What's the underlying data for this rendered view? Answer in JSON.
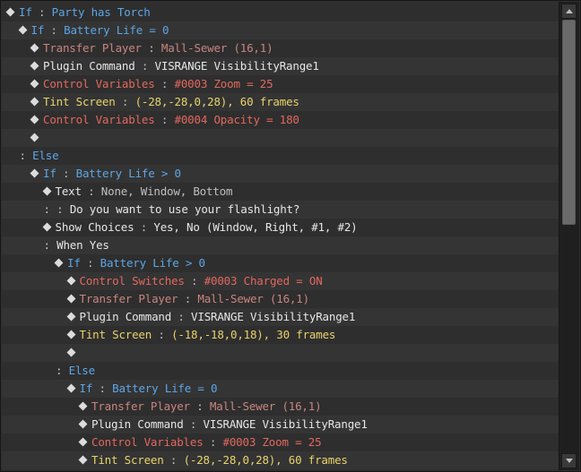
{
  "rows": [
    {
      "indent": 0,
      "diamond": true,
      "parts": [
        {
          "t": "If",
          "c": "c-blue"
        },
        {
          "t": " : ",
          "c": "colon-sep"
        },
        {
          "t": "Party has Torch",
          "c": "c-blue"
        }
      ]
    },
    {
      "indent": 1,
      "diamond": true,
      "parts": [
        {
          "t": "If",
          "c": "c-blue"
        },
        {
          "t": " : ",
          "c": "colon-sep"
        },
        {
          "t": "Battery Life = 0",
          "c": "c-blue"
        }
      ]
    },
    {
      "indent": 2,
      "diamond": true,
      "parts": [
        {
          "t": "Transfer Player",
          "c": "c-red-dim"
        },
        {
          "t": " : ",
          "c": "colon-sep"
        },
        {
          "t": "Mall-Sewer (16,1)",
          "c": "c-red-dim"
        }
      ]
    },
    {
      "indent": 2,
      "diamond": true,
      "parts": [
        {
          "t": "Plugin Command",
          "c": "c-white"
        },
        {
          "t": " : ",
          "c": "colon-sep"
        },
        {
          "t": "VISRANGE VisibilityRange1",
          "c": "c-white"
        }
      ]
    },
    {
      "indent": 2,
      "diamond": true,
      "parts": [
        {
          "t": "Control Variables",
          "c": "c-red"
        },
        {
          "t": " : ",
          "c": "colon-sep"
        },
        {
          "t": "#0003 Zoom = 25",
          "c": "c-red"
        }
      ]
    },
    {
      "indent": 2,
      "diamond": true,
      "parts": [
        {
          "t": "Tint Screen",
          "c": "c-yellow"
        },
        {
          "t": " : ",
          "c": "colon-sep"
        },
        {
          "t": "(-28,-28,0,28), 60 frames",
          "c": "c-yellow"
        }
      ]
    },
    {
      "indent": 2,
      "diamond": true,
      "parts": [
        {
          "t": "Control Variables",
          "c": "c-red"
        },
        {
          "t": " : ",
          "c": "colon-sep"
        },
        {
          "t": "#0004 Opacity = 180",
          "c": "c-red"
        }
      ]
    },
    {
      "indent": 2,
      "diamond": true,
      "parts": []
    },
    {
      "indent": 1,
      "diamond": false,
      "parts": [
        {
          "t": " : ",
          "c": "colon-sep"
        },
        {
          "t": "Else",
          "c": "c-blue"
        }
      ]
    },
    {
      "indent": 2,
      "diamond": true,
      "parts": [
        {
          "t": "If",
          "c": "c-blue"
        },
        {
          "t": " : ",
          "c": "colon-sep"
        },
        {
          "t": "Battery Life > 0",
          "c": "c-blue"
        }
      ]
    },
    {
      "indent": 3,
      "diamond": true,
      "parts": [
        {
          "t": "Text",
          "c": "c-white"
        },
        {
          "t": " : ",
          "c": "colon-sep"
        },
        {
          "t": "None, Window, Bottom",
          "c": "c-gray"
        }
      ]
    },
    {
      "indent": 3,
      "diamond": false,
      "parts": [
        {
          "t": " :       : ",
          "c": "colon-sep"
        },
        {
          "t": "Do you want to use your flashlight?",
          "c": "c-white"
        }
      ]
    },
    {
      "indent": 3,
      "diamond": true,
      "parts": [
        {
          "t": "Show Choices",
          "c": "c-white"
        },
        {
          "t": " : ",
          "c": "colon-sep"
        },
        {
          "t": "Yes, No (Window, Right, #1, #2)",
          "c": "c-white"
        }
      ]
    },
    {
      "indent": 3,
      "diamond": false,
      "parts": [
        {
          "t": " : ",
          "c": "colon-sep"
        },
        {
          "t": "When Yes",
          "c": "c-white"
        }
      ]
    },
    {
      "indent": 4,
      "diamond": true,
      "parts": [
        {
          "t": "If",
          "c": "c-blue"
        },
        {
          "t": " : ",
          "c": "colon-sep"
        },
        {
          "t": "Battery Life > 0",
          "c": "c-blue"
        }
      ]
    },
    {
      "indent": 5,
      "diamond": true,
      "parts": [
        {
          "t": "Control Switches",
          "c": "c-red"
        },
        {
          "t": " : ",
          "c": "colon-sep"
        },
        {
          "t": "#0003 Charged = ON",
          "c": "c-red"
        }
      ]
    },
    {
      "indent": 5,
      "diamond": true,
      "parts": [
        {
          "t": "Transfer Player",
          "c": "c-red-dim"
        },
        {
          "t": " : ",
          "c": "colon-sep"
        },
        {
          "t": "Mall-Sewer (16,1)",
          "c": "c-red-dim"
        }
      ]
    },
    {
      "indent": 5,
      "diamond": true,
      "parts": [
        {
          "t": "Plugin Command",
          "c": "c-white"
        },
        {
          "t": " : ",
          "c": "colon-sep"
        },
        {
          "t": "VISRANGE VisibilityRange1",
          "c": "c-white"
        }
      ]
    },
    {
      "indent": 5,
      "diamond": true,
      "parts": [
        {
          "t": "Tint Screen",
          "c": "c-yellow"
        },
        {
          "t": " : ",
          "c": "colon-sep"
        },
        {
          "t": "(-18,-18,0,18), 30 frames",
          "c": "c-yellow"
        }
      ]
    },
    {
      "indent": 5,
      "diamond": true,
      "parts": []
    },
    {
      "indent": 4,
      "diamond": false,
      "parts": [
        {
          "t": " : ",
          "c": "colon-sep"
        },
        {
          "t": "Else",
          "c": "c-blue"
        }
      ]
    },
    {
      "indent": 5,
      "diamond": true,
      "parts": [
        {
          "t": "If",
          "c": "c-blue"
        },
        {
          "t": " : ",
          "c": "colon-sep"
        },
        {
          "t": "Battery Life = 0",
          "c": "c-blue"
        }
      ]
    },
    {
      "indent": 6,
      "diamond": true,
      "parts": [
        {
          "t": "Transfer Player",
          "c": "c-red-dim"
        },
        {
          "t": " : ",
          "c": "colon-sep"
        },
        {
          "t": "Mall-Sewer (16,1)",
          "c": "c-red-dim"
        }
      ]
    },
    {
      "indent": 6,
      "diamond": true,
      "parts": [
        {
          "t": "Plugin Command",
          "c": "c-white"
        },
        {
          "t": " : ",
          "c": "colon-sep"
        },
        {
          "t": "VISRANGE VisibilityRange1",
          "c": "c-white"
        }
      ]
    },
    {
      "indent": 6,
      "diamond": true,
      "parts": [
        {
          "t": "Control Variables",
          "c": "c-red"
        },
        {
          "t": " : ",
          "c": "colon-sep"
        },
        {
          "t": "#0003 Zoom = 25",
          "c": "c-red"
        }
      ]
    },
    {
      "indent": 6,
      "diamond": true,
      "parts": [
        {
          "t": "Tint Screen",
          "c": "c-yellow"
        },
        {
          "t": " : ",
          "c": "colon-sep"
        },
        {
          "t": "(-28,-28,0,28), 60 frames",
          "c": "c-yellow"
        }
      ]
    }
  ],
  "scrollbar": {
    "up_icon": "arrow-up-icon",
    "down_icon": "arrow-down-icon"
  }
}
